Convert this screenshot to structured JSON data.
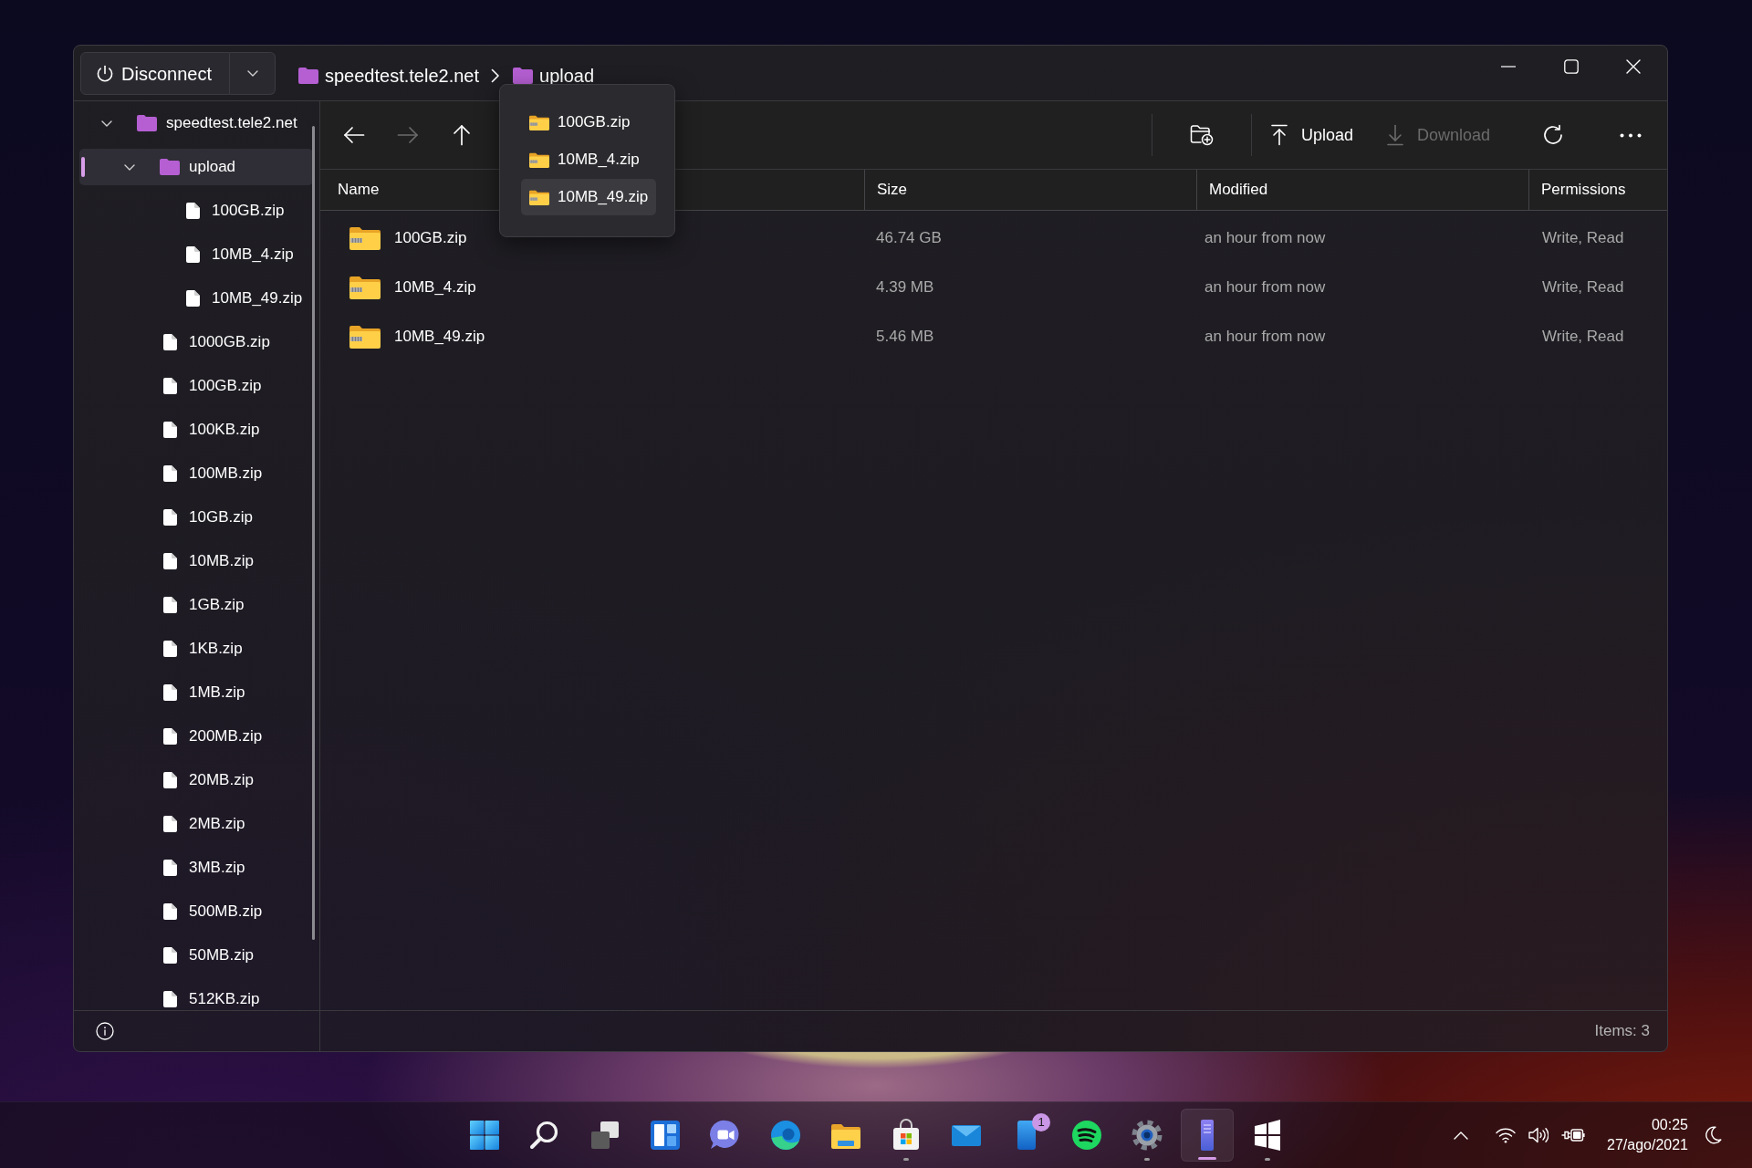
{
  "title_bar": {
    "disconnect_button": {
      "label": "Disconnect"
    },
    "breadcrumb": [
      {
        "label": "speedtest.tele2.net"
      },
      {
        "label": "upload"
      }
    ]
  },
  "breadcrumb_menu": {
    "items": [
      {
        "label": "100GB.zip",
        "selected": false
      },
      {
        "label": "10MB_4.zip",
        "selected": false
      },
      {
        "label": "10MB_49.zip",
        "selected": true
      }
    ]
  },
  "sidebar": {
    "tree": [
      {
        "label": "speedtest.tele2.net",
        "kind": "folder",
        "expanded": true,
        "selected": false,
        "children": [
          {
            "label": "upload",
            "kind": "folder",
            "expanded": true,
            "selected": true,
            "children": [
              {
                "label": "100GB.zip",
                "kind": "file",
                "selected": false
              },
              {
                "label": "10MB_4.zip",
                "kind": "file",
                "selected": false
              },
              {
                "label": "10MB_49.zip",
                "kind": "file",
                "selected": false
              }
            ]
          },
          {
            "label": "1000GB.zip",
            "kind": "file",
            "selected": false
          },
          {
            "label": "100GB.zip",
            "kind": "file",
            "selected": false
          },
          {
            "label": "100KB.zip",
            "kind": "file",
            "selected": false
          },
          {
            "label": "100MB.zip",
            "kind": "file",
            "selected": false
          },
          {
            "label": "10GB.zip",
            "kind": "file",
            "selected": false
          },
          {
            "label": "10MB.zip",
            "kind": "file",
            "selected": false
          },
          {
            "label": "1GB.zip",
            "kind": "file",
            "selected": false
          },
          {
            "label": "1KB.zip",
            "kind": "file",
            "selected": false
          },
          {
            "label": "1MB.zip",
            "kind": "file",
            "selected": false
          },
          {
            "label": "200MB.zip",
            "kind": "file",
            "selected": false
          },
          {
            "label": "20MB.zip",
            "kind": "file",
            "selected": false
          },
          {
            "label": "2MB.zip",
            "kind": "file",
            "selected": false
          },
          {
            "label": "3MB.zip",
            "kind": "file",
            "selected": false
          },
          {
            "label": "500MB.zip",
            "kind": "file",
            "selected": false
          },
          {
            "label": "50MB.zip",
            "kind": "file",
            "selected": false
          },
          {
            "label": "512KB.zip",
            "kind": "file",
            "selected": false
          }
        ]
      }
    ]
  },
  "toolbar": {
    "back": {
      "disabled": false
    },
    "forward": {
      "disabled": true
    },
    "up": {
      "disabled": false
    },
    "upload": {
      "label": "Upload",
      "disabled": false
    },
    "download": {
      "label": "Download",
      "disabled": true
    }
  },
  "table": {
    "columns": [
      "Name",
      "Size",
      "Modified",
      "Permissions"
    ],
    "rows": [
      {
        "name": "100GB.zip",
        "size": "46.74 GB",
        "modified": "an hour from now",
        "permissions": "Write, Read",
        "selected": false
      },
      {
        "name": "10MB_4.zip",
        "size": "4.39 MB",
        "modified": "an hour from now",
        "permissions": "Write, Read",
        "selected": false
      },
      {
        "name": "10MB_49.zip",
        "size": "5.46 MB",
        "modified": "an hour from now",
        "permissions": "Write, Read",
        "selected": false
      }
    ]
  },
  "status_bar": {
    "items": "Items: 3"
  },
  "taskbar": {
    "apps": [
      {
        "kind": "start",
        "running": false,
        "active": false
      },
      {
        "kind": "search",
        "running": false,
        "active": false
      },
      {
        "kind": "task_view",
        "running": false,
        "active": false
      },
      {
        "kind": "widgets",
        "running": false,
        "active": false
      },
      {
        "kind": "chat",
        "running": false,
        "active": false
      },
      {
        "kind": "browser",
        "running": false,
        "active": false
      },
      {
        "kind": "file_explorer",
        "running": false,
        "active": false
      },
      {
        "kind": "store",
        "running": true,
        "active": false
      },
      {
        "kind": "mail",
        "running": false,
        "active": false
      },
      {
        "kind": "phone",
        "running": false,
        "active": false,
        "badge": "1"
      },
      {
        "kind": "music",
        "running": false,
        "active": false
      },
      {
        "kind": "settings",
        "running": true,
        "active": false
      },
      {
        "kind": "server",
        "running": true,
        "active": true
      },
      {
        "kind": "panes",
        "running": true,
        "active": false
      }
    ],
    "clock": {
      "time": "00:25",
      "date": "27/ago/2021"
    }
  }
}
